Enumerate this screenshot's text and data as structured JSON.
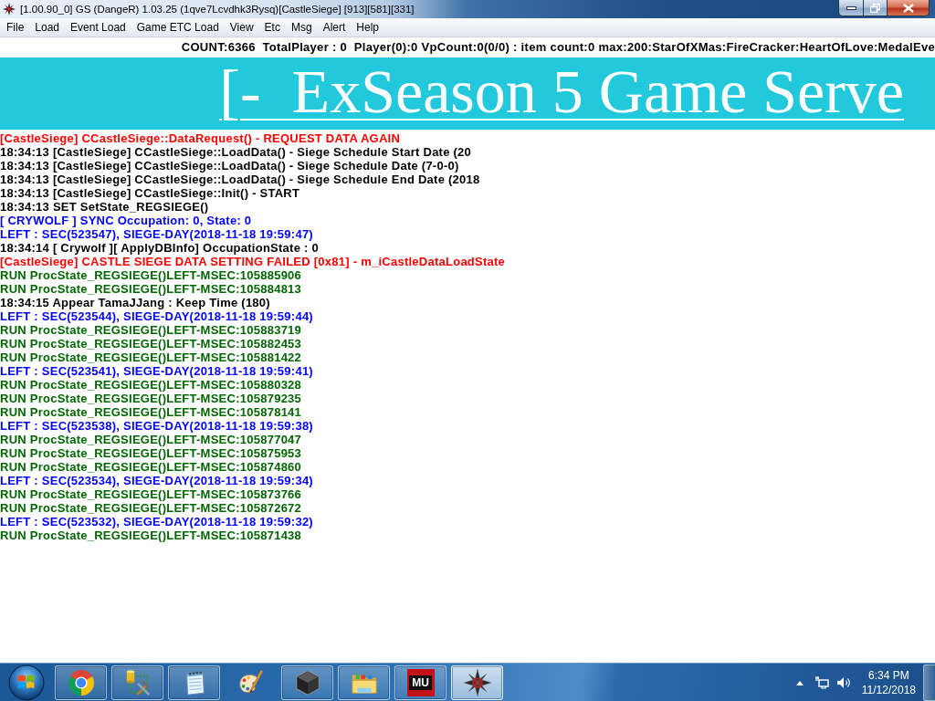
{
  "window": {
    "title": "[1.00.90_0] GS (DangeR) 1.03.25 (1qve7Lcvdhk3Rysq)[CastleSiege] [913][581][331]"
  },
  "menu": [
    "File",
    "Load",
    "Event Load",
    "Game ETC Load",
    "View",
    "Etc",
    "Msg",
    "Alert",
    "Help"
  ],
  "status_line": "COUNT:6366  TotalPlayer : 0  Player(0):0 VpCount:0(0/0) : item count:0 max:200:StarOfXMas:FireCracker:HeartOfLove:MedalEve",
  "banner": {
    "text": "[-  ExSeason 5 Game Serve"
  },
  "log": [
    {
      "text": "[CastleSiege] CCastleSiege::DataRequest() - REQUEST DATA AGAIN",
      "color": "#ff0000"
    },
    {
      "text": "18:34:13 [CastleSiege] CCastleSiege::LoadData() - Siege Schedule Start Date (20",
      "color": "#000000"
    },
    {
      "text": "18:34:13 [CastleSiege] CCastleSiege::LoadData() - Siege Schedule Date (7-0-0)",
      "color": "#000000"
    },
    {
      "text": "18:34:13 [CastleSiege] CCastleSiege::LoadData() - Siege Schedule End Date (2018",
      "color": "#000000"
    },
    {
      "text": "18:34:13 [CastleSiege] CCastleSiege::Init() - START",
      "color": "#000000"
    },
    {
      "text": "18:34:13 SET SetState_REGSIEGE()",
      "color": "#000000"
    },
    {
      "text": "[ CRYWOLF ] SYNC Occupation: 0, State: 0",
      "color": "#0000ff"
    },
    {
      "text": "LEFT : SEC(523547), SIEGE-DAY(2018-11-18 19:59:47)",
      "color": "#0000ff"
    },
    {
      "text": "18:34:14 [ Crywolf ][ ApplyDBInfo] OccupationState : 0",
      "color": "#000000"
    },
    {
      "text": "[CastleSiege] CASTLE SIEGE DATA SETTING FAILED [0x81] - m_iCastleDataLoadState",
      "color": "#ff0000"
    },
    {
      "text": "RUN ProcState_REGSIEGE()LEFT-MSEC:105885906",
      "color": "#006600"
    },
    {
      "text": "RUN ProcState_REGSIEGE()LEFT-MSEC:105884813",
      "color": "#006600"
    },
    {
      "text": "18:34:15 Appear TamaJJang : Keep Time (180)",
      "color": "#000000"
    },
    {
      "text": "LEFT : SEC(523544), SIEGE-DAY(2018-11-18 19:59:44)",
      "color": "#0000ff"
    },
    {
      "text": "RUN ProcState_REGSIEGE()LEFT-MSEC:105883719",
      "color": "#006600"
    },
    {
      "text": "RUN ProcState_REGSIEGE()LEFT-MSEC:105882453",
      "color": "#006600"
    },
    {
      "text": "RUN ProcState_REGSIEGE()LEFT-MSEC:105881422",
      "color": "#006600"
    },
    {
      "text": "LEFT : SEC(523541), SIEGE-DAY(2018-11-18 19:59:41)",
      "color": "#0000ff"
    },
    {
      "text": "RUN ProcState_REGSIEGE()LEFT-MSEC:105880328",
      "color": "#006600"
    },
    {
      "text": "RUN ProcState_REGSIEGE()LEFT-MSEC:105879235",
      "color": "#006600"
    },
    {
      "text": "RUN ProcState_REGSIEGE()LEFT-MSEC:105878141",
      "color": "#006600"
    },
    {
      "text": "LEFT : SEC(523538), SIEGE-DAY(2018-11-18 19:59:38)",
      "color": "#0000ff"
    },
    {
      "text": "RUN ProcState_REGSIEGE()LEFT-MSEC:105877047",
      "color": "#006600"
    },
    {
      "text": "RUN ProcState_REGSIEGE()LEFT-MSEC:105875953",
      "color": "#006600"
    },
    {
      "text": "RUN ProcState_REGSIEGE()LEFT-MSEC:105874860",
      "color": "#006600"
    },
    {
      "text": "LEFT : SEC(523534), SIEGE-DAY(2018-11-18 19:59:34)",
      "color": "#0000ff"
    },
    {
      "text": "RUN ProcState_REGSIEGE()LEFT-MSEC:105873766",
      "color": "#006600"
    },
    {
      "text": "RUN ProcState_REGSIEGE()LEFT-MSEC:105872672",
      "color": "#006600"
    },
    {
      "text": "LEFT : SEC(523532), SIEGE-DAY(2018-11-18 19:59:32)",
      "color": "#0000ff"
    },
    {
      "text": "RUN ProcState_REGSIEGE()LEFT-MSEC:105871438",
      "color": "#006600"
    }
  ],
  "taskbar": {
    "items": [
      {
        "kind": "browser",
        "running": true,
        "selected": false
      },
      {
        "kind": "tools",
        "running": true,
        "selected": false
      },
      {
        "kind": "notepad",
        "running": true,
        "selected": false
      },
      {
        "kind": "paint",
        "running": false,
        "selected": false
      },
      {
        "kind": "cube",
        "running": true,
        "selected": false
      },
      {
        "kind": "folder",
        "running": true,
        "selected": false
      },
      {
        "kind": "logo",
        "label": "MU",
        "running": true,
        "selected": false
      },
      {
        "kind": "emblem",
        "running": true,
        "selected": true
      }
    ],
    "clock": {
      "time": "6:34 PM",
      "date": "11/12/2018"
    }
  }
}
